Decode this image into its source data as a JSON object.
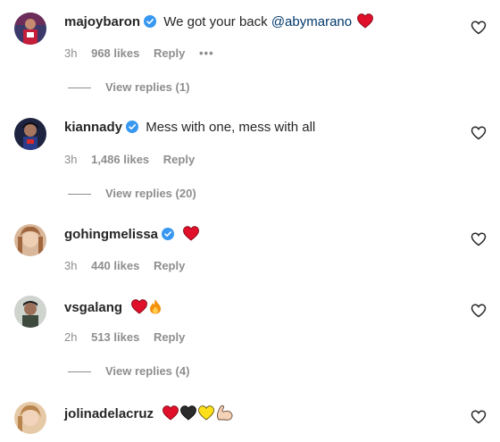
{
  "comments": [
    {
      "username": "majoybaron",
      "verified": true,
      "text": "We got your back",
      "mention": "@abymarano",
      "emojis": [
        "red-heart"
      ],
      "time": "3h",
      "likes": "968 likes",
      "reply": "Reply",
      "more": "•••",
      "replies": "View replies (1)"
    },
    {
      "username": "kiannady",
      "verified": true,
      "text": "Mess with one, mess with all",
      "time": "3h",
      "likes": "1,486 likes",
      "reply": "Reply",
      "replies": "View replies (20)"
    },
    {
      "username": "gohingmelissa",
      "verified": true,
      "text": "",
      "emojis": [
        "red-heart"
      ],
      "time": "3h",
      "likes": "440 likes",
      "reply": "Reply"
    },
    {
      "username": "vsgalang",
      "verified": false,
      "text": "",
      "emojis": [
        "red-heart",
        "fire"
      ],
      "time": "2h",
      "likes": "513 likes",
      "reply": "Reply",
      "replies": "View replies (4)"
    },
    {
      "username": "jolinadelacruz",
      "verified": false,
      "text": "",
      "emojis": [
        "red-heart",
        "black-heart",
        "yellow-heart",
        "flexed-biceps"
      ]
    }
  ],
  "colors": {
    "verified_blue": "#3897f0",
    "mention_blue": "#00376b",
    "heart_red": "#e0102a",
    "muted_text": "#8e8e8e"
  }
}
